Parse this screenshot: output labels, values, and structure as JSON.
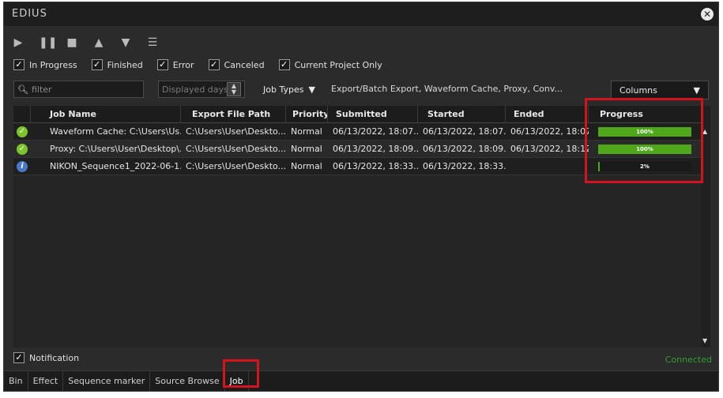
{
  "app": {
    "title": "EDIUS"
  },
  "filters": [
    {
      "label": "In Progress",
      "checked": true
    },
    {
      "label": "Finished",
      "checked": true
    },
    {
      "label": "Error",
      "checked": true
    },
    {
      "label": "Canceled",
      "checked": true
    },
    {
      "label": "Current Project Only",
      "checked": true
    }
  ],
  "search": {
    "placeholder": "filter"
  },
  "days": {
    "placeholder": "Displayed days"
  },
  "job_types": {
    "label": "Job Types",
    "value": "Export/Batch Export, Waveform Cache, Proxy, Conv..."
  },
  "columns_button": "Columns",
  "table": {
    "headers": [
      "Job Name",
      "Export File Path",
      "Priority",
      "Submitted",
      "Started",
      "Ended",
      "Progress"
    ],
    "rows": [
      {
        "status": "finished",
        "job_name": "Waveform Cache: C:\\Users\\Us...",
        "path": "C:\\Users\\User\\Deskto...",
        "priority": "Normal",
        "submitted": "06/13/2022, 18:07...",
        "started": "06/13/2022, 18:07...",
        "ended": "06/13/2022, 18:07:",
        "progress": 100,
        "progress_text": "100%"
      },
      {
        "status": "finished",
        "job_name": "Proxy: C:\\Users\\User\\Desktop\\...",
        "path": "C:\\Users\\User\\Deskto...",
        "priority": "Normal",
        "submitted": "06/13/2022, 18:09...",
        "started": "06/13/2022, 18:09...",
        "ended": "06/13/2022, 18:12:",
        "progress": 100,
        "progress_text": "100%"
      },
      {
        "status": "in-progress",
        "job_name": "NIKON_Sequence1_2022-06-1...",
        "path": "C:\\Users\\User\\Deskto...",
        "priority": "Normal",
        "submitted": "06/13/2022, 18:33...",
        "started": "06/13/2022, 18:33...",
        "ended": "",
        "progress": 2,
        "progress_text": "2%"
      }
    ]
  },
  "notification": {
    "label": "Notification",
    "checked": true
  },
  "connection_status": "Connected",
  "tabs": [
    "Bin",
    "Effect",
    "Sequence marker",
    "Source Browse",
    "Job"
  ],
  "active_tab": "Job",
  "colors": {
    "progress_fill": "#4fa81a",
    "highlight": "#d4141c",
    "connected": "#2fa02f"
  }
}
